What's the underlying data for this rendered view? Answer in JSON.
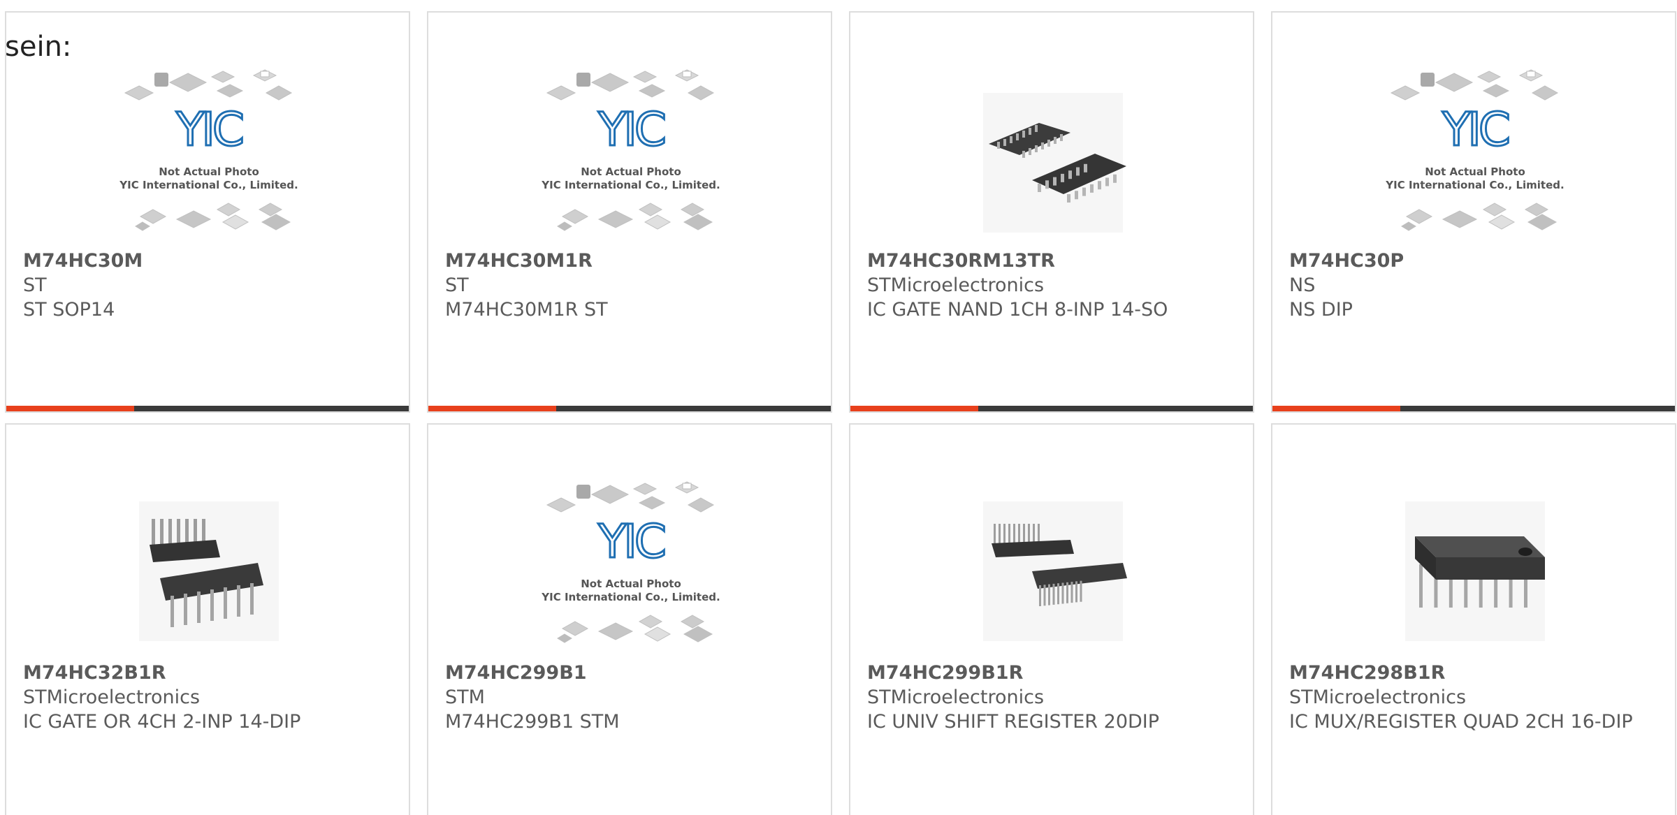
{
  "intro_text": "sein:",
  "colors": {
    "accent": "#e8401c",
    "bar": "#3a3a3a",
    "text": "#5a5a5a",
    "border": "#dddddd",
    "logo_blue": "#1f6fb2"
  },
  "placeholder": {
    "logo": "YIC",
    "line1": "Not Actual Photo",
    "line2": "YIC International Co., Limited."
  },
  "products": [
    {
      "part": "M74HC30M",
      "manufacturer": "ST",
      "description": "ST SOP14",
      "image": "yic-placeholder"
    },
    {
      "part": "M74HC30M1R",
      "manufacturer": "ST",
      "description": "M74HC30M1R ST",
      "image": "yic-placeholder"
    },
    {
      "part": "M74HC30RM13TR",
      "manufacturer": "STMicroelectronics",
      "description": "IC GATE NAND 1CH 8-INP 14-SO",
      "image": "soic-chip"
    },
    {
      "part": "M74HC30P",
      "manufacturer": "NS",
      "description": "NS DIP",
      "image": "yic-placeholder"
    },
    {
      "part": "M74HC32B1R",
      "manufacturer": "STMicroelectronics",
      "description": "IC GATE OR 4CH 2-INP 14-DIP",
      "image": "dip14-chip"
    },
    {
      "part": "M74HC299B1",
      "manufacturer": "STM",
      "description": "M74HC299B1 STM",
      "image": "yic-placeholder"
    },
    {
      "part": "M74HC299B1R",
      "manufacturer": "STMicroelectronics",
      "description": "IC UNIV SHIFT REGISTER 20DIP",
      "image": "dip20-chip"
    },
    {
      "part": "M74HC298B1R",
      "manufacturer": "STMicroelectronics",
      "description": "IC MUX/REGISTER QUAD 2CH 16-DIP",
      "image": "dip16-chip"
    }
  ]
}
